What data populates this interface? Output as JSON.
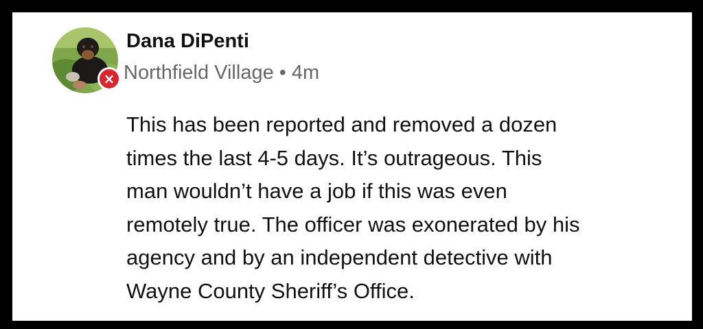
{
  "comment": {
    "author": "Dana DiPenti",
    "location": "Northfield Village",
    "separator": "•",
    "timestamp": "4m",
    "badge_icon": "close-icon",
    "badge_color": "#d7262e",
    "body_lines": [
      "This has been reported and removed a dozen",
      "times the last 4-5 days. It’s outrageous. This",
      "man wouldn’t have a job if this was even",
      "remotely true. The officer was exonerated by his",
      "agency and by an independent detective with",
      "Wayne County Sheriff’s Office."
    ]
  }
}
